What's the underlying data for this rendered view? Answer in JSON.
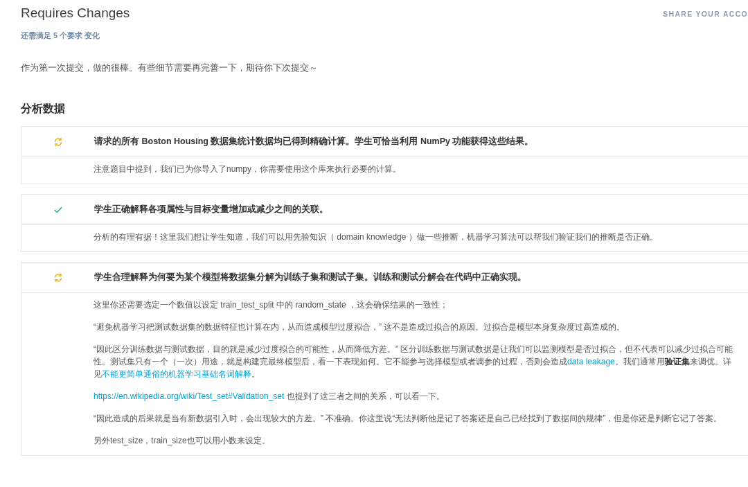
{
  "header": {
    "title": "Requires Changes",
    "share_link": "SHARE YOUR ACCO",
    "summary": "还需满足 5 个要求 变化"
  },
  "intro": "作为第一次提交，做的很棒。有些细节需要再完善一下，期待你下次提交～",
  "section": {
    "title": "分析数据",
    "requirements": [
      {
        "kind": "pending",
        "title": "请求的所有 Boston Housing 数据集统计数据均已得到精确计算。学生可恰当利用 NumPy 功能获得这些结果。",
        "comments": [
          [
            {
              "kind": "text",
              "text": "注意题目中提到，我们已为你导入了numpy，你需要使用这个库来执行必要的计算。"
            }
          ]
        ]
      },
      {
        "kind": "passed",
        "title": "学生正确解释各项属性与目标变量增加或减少之间的关联。",
        "comments": [
          [
            {
              "kind": "text",
              "text": "分析的有理有据！这里我们想让学生知道，我们可以用先验知识（ domain knowledge ）做一些推断，机器学习算法可以帮我们验证我们的推断是否正确。"
            }
          ]
        ]
      },
      {
        "kind": "pending",
        "title": "学生合理解释为何要为某个模型将数据集分解为训练子集和测试子集。训练和测试分解会在代码中正确实现。",
        "comments": [
          [
            {
              "kind": "text",
              "text": "这里你还需要选定一个数值以设定 train_test_split 中的 random_state ，这会确保结果的一致性；"
            }
          ],
          [
            {
              "kind": "text",
              "text": "“避免机器学习把测试数据集的数据特征也计算在内，从而造成模型过度拟合，” 这不是造成过拟合的原因。过拟合是模型本身复杂度过高造成的。"
            }
          ],
          [
            {
              "kind": "text",
              "text": "“因此区分训练数据与测试数据，目的就是减少过度拟合的可能性，从而降低方差。” 区分训练数据与测试数据是让我们可以监测模型是否过拟合，但不代表可以减少过拟合可能性。测试集只有一个（一次）用途，就是构建完最终模型后，看一下表现如何。它不能参与选择模型或者调参的过程，否则会造成"
            },
            {
              "kind": "link",
              "text": "data leakage"
            },
            {
              "kind": "text",
              "text": "。我们通常用"
            },
            {
              "kind": "bold",
              "text": "验证集"
            },
            {
              "kind": "text",
              "text": "来调优。详见"
            },
            {
              "kind": "link",
              "text": "不能更简单通俗的机器学习基础名词解释"
            },
            {
              "kind": "text",
              "text": "。"
            }
          ],
          [
            {
              "kind": "link",
              "text": "https://en.wikipedia.org/wiki/Test_set#Validation_set"
            },
            {
              "kind": "text",
              "text": " 也提到了这三者之间的关系，可以看一下。"
            }
          ],
          [
            {
              "kind": "text",
              "text": "“因此造成的后果就是当有新数据引入时，会出现较大的方差。” 不准确。你这里说“无法判断他是记了答案还是自己已经找到了数据间的规律”，但是你还是判断它记了答案。"
            }
          ],
          [
            {
              "kind": "text",
              "text": "另外test_size，train_size也可以用小数来设定。"
            }
          ]
        ]
      }
    ]
  }
}
